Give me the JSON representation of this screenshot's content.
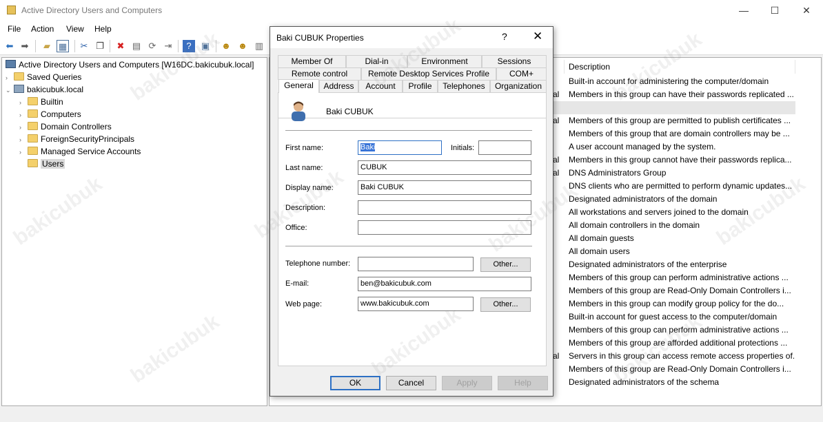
{
  "window": {
    "title": "Active Directory Users and Computers",
    "minimize": "—",
    "maximize": "☐",
    "close": "✕"
  },
  "menu": [
    "File",
    "Action",
    "View",
    "Help"
  ],
  "toolbar_icons": [
    "back-icon",
    "forward-icon",
    "up-folder-icon",
    "show-console-tree-icon",
    "cut-icon",
    "copy-icon",
    "delete-icon",
    "properties-icon",
    "refresh-icon",
    "export-list-icon",
    "help-icon",
    "console-icon",
    "new-user-icon",
    "new-group-icon",
    "new-ou-icon"
  ],
  "tree": {
    "root": "Active Directory Users and Computers [W16DC.bakicubuk.local]",
    "saved_queries": "Saved Queries",
    "domain": "bakicubuk.local",
    "children": [
      "Builtin",
      "Computers",
      "Domain Controllers",
      "ForeignSecurityPrincipals",
      "Managed Service Accounts",
      "Users"
    ],
    "selected": "Users"
  },
  "list": {
    "column_description": "Description",
    "type_fragment": "al",
    "rows": [
      "Built-in account for administering the computer/domain",
      "Members in this group can have their passwords replicated ...",
      "",
      "Members of this group are permitted to publish certificates ...",
      "Members of this group that are domain controllers may be ...",
      "A user account managed by the system.",
      "Members in this group cannot have their passwords replica...",
      "DNS Administrators Group",
      "DNS clients who are permitted to perform dynamic updates...",
      "Designated administrators of the domain",
      "All workstations and servers joined to the domain",
      "All domain controllers in the domain",
      "All domain guests",
      "All domain users",
      "Designated administrators of the enterprise",
      "Members of this group can perform administrative actions ...",
      "Members of this group are Read-Only Domain Controllers i...",
      "Members in this group can modify group policy for the do...",
      "Built-in account for guest access to the computer/domain",
      "Members of this group can perform administrative actions ...",
      "Members of this group are afforded additional protections ...",
      "Servers in this group can access remote access properties of...",
      "Members of this group are Read-Only Domain Controllers i...",
      "Designated administrators of the schema"
    ]
  },
  "dialog": {
    "title": "Baki CUBUK Properties",
    "help": "?",
    "close": "✕",
    "tabs_row1": [
      "Member Of",
      "Dial-in",
      "Environment",
      "Sessions"
    ],
    "tabs_row2": [
      "Remote control",
      "Remote Desktop Services Profile",
      "COM+"
    ],
    "tabs_row3": [
      "General",
      "Address",
      "Account",
      "Profile",
      "Telephones",
      "Organization"
    ],
    "active_tab": "General",
    "user_display": "Baki CUBUK",
    "labels": {
      "first_name": "First name:",
      "initials": "Initials:",
      "last_name": "Last name:",
      "display_name": "Display name:",
      "description": "Description:",
      "office": "Office:",
      "telephone": "Telephone number:",
      "email": "E-mail:",
      "web_page": "Web page:"
    },
    "values": {
      "first_name": "Baki",
      "initials": "",
      "last_name": "CUBUK",
      "display_name": "Baki CUBUK",
      "description": "",
      "office": "",
      "telephone": "",
      "email": "ben@bakicubuk.com",
      "web_page": "www.bakicubuk.com"
    },
    "other_button": "Other...",
    "buttons": {
      "ok": "OK",
      "cancel": "Cancel",
      "apply": "Apply",
      "help": "Help"
    }
  },
  "watermark": "bakicubuk"
}
